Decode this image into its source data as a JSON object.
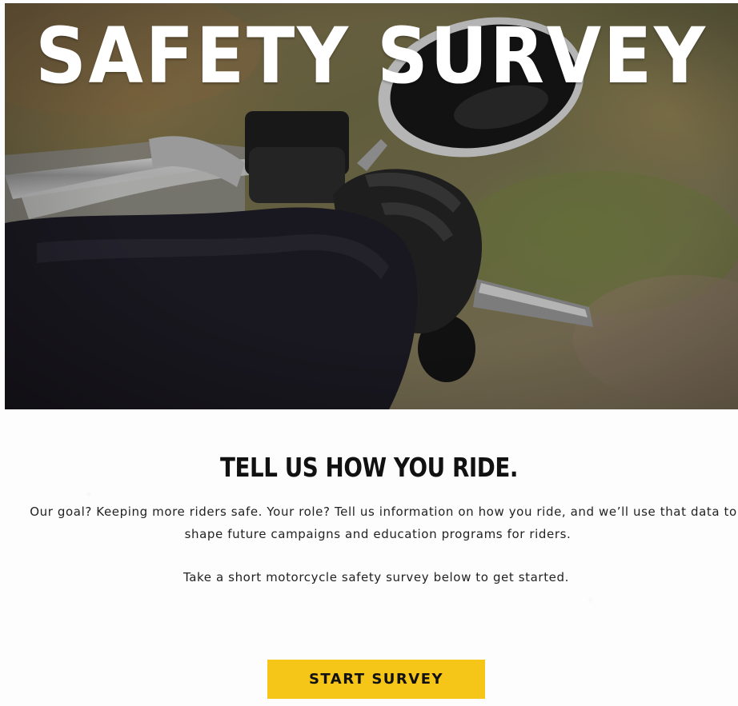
{
  "hero": {
    "title": "SAFETY SURVEY",
    "image_icon": "motorcycle-handlebar-photo"
  },
  "content": {
    "headline": "TELL US HOW YOU RIDE.",
    "intro_line1": "Our goal? Keeping more riders safe. Your role? Tell us information on how you ride, and we’ll use that data to",
    "intro_line2": "shape future campaigns and education programs for riders.",
    "cta_text": "Take a short motorcycle safety survey below to get started."
  },
  "button": {
    "label": "START SURVEY",
    "color": "#f5c518"
  }
}
